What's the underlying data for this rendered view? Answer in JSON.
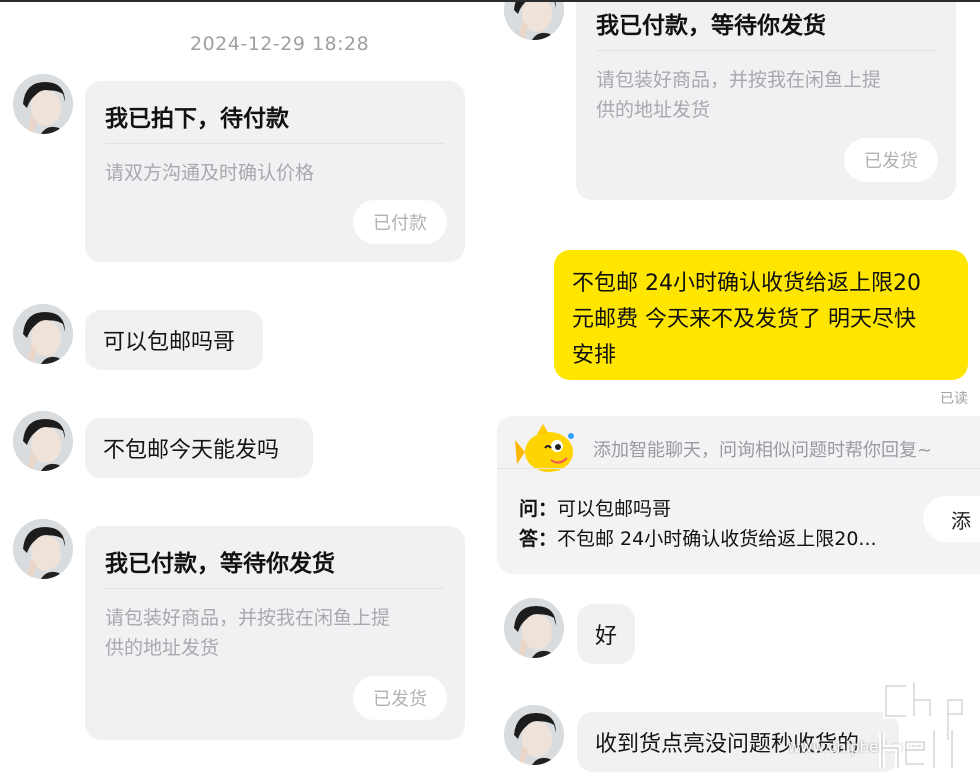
{
  "left_panel": {
    "timestamp": "2024-12-29 18:28",
    "card_paid_pending": {
      "title": "我已拍下，待付款",
      "description": "请双方沟通及时确认价格",
      "button": "已付款"
    },
    "msg_free_shipping": "可以包邮吗哥",
    "msg_ship_today": "不包邮今天能发吗",
    "card_waiting_ship": {
      "title": "我已付款，等待你发货",
      "description_line1": "请包装好商品，并按我在闲鱼上提",
      "description_line2": "供的地址发货",
      "button": "已发货"
    }
  },
  "right_panel": {
    "card_waiting_ship": {
      "title": "我已付款，等待你发货",
      "description_line1": "请包装好商品，并按我在闲鱼上提",
      "description_line2": "供的地址发货",
      "button": "已发货"
    },
    "seller_reply_lines": [
      "不包邮 24小时确认收货给返上限20",
      "元邮费 今天来不及发货了 明天尽快",
      "安排"
    ],
    "read_status": "已读",
    "ai_suggest": {
      "hint": "添加智能聊天，问询相似问题时帮你回复~",
      "q_label": "问：",
      "q_text": "可以包邮吗哥",
      "a_label": "答：",
      "a_text": "不包邮 24小时确认收货给返上限20...",
      "add_button": "添"
    },
    "msg_ok": "好",
    "msg_confirm": "收到货点亮没问题秒收货的"
  },
  "watermark": {
    "site": "www.chiphell.com"
  },
  "colors": {
    "bubble_gray": "#f1f1f3",
    "seller_yellow": "#ffe600",
    "muted_text": "#a9a9ad"
  }
}
